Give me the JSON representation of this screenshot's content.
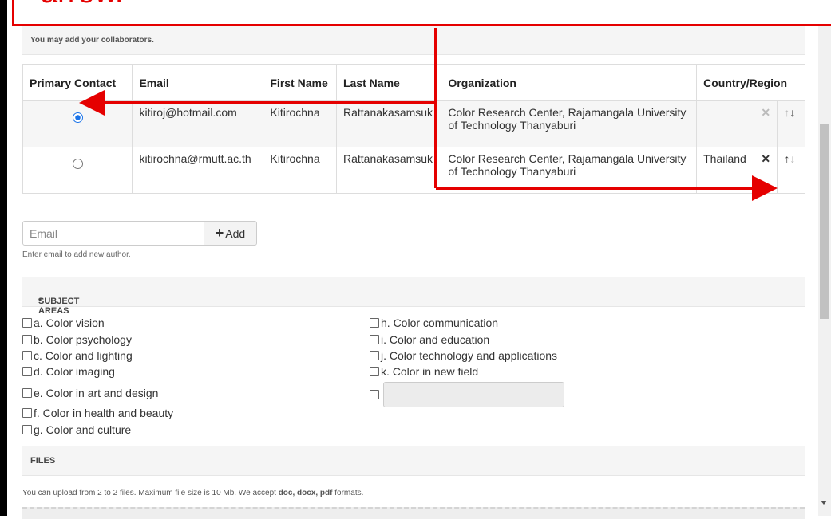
{
  "annotation": {
    "text": "arrow."
  },
  "collaborators_note": "You may add your collaborators.",
  "authors_table": {
    "headers": [
      "Primary Contact",
      "Email",
      "First Name",
      "Last Name",
      "Organization",
      "Country/Region"
    ],
    "rows": [
      {
        "primary": true,
        "email": "kitiroj@hotmail.com",
        "first": "Kitirochna",
        "last": "Rattanakasamsuk",
        "org": "Color Research Center, Rajamangala University of Technology Thanyaburi",
        "country": "",
        "remove": "✕",
        "up": "↑",
        "down": "↓"
      },
      {
        "primary": false,
        "email": "kitirochna@rmutt.ac.th",
        "first": "Kitirochna",
        "last": "Rattanakasamsuk",
        "org": "Color Research Center, Rajamangala University of Technology Thanyaburi",
        "country": "Thailand",
        "remove": "✕",
        "up": "↑",
        "down": "↓"
      }
    ]
  },
  "add_author": {
    "placeholder": "Email",
    "button": "Add",
    "hint": "Enter email to add new author."
  },
  "subject_areas": {
    "title": "SUBJECT AREAS",
    "required": "*",
    "left": [
      "a. Color vision",
      "b. Color psychology",
      "c. Color and lighting",
      "d. Color imaging",
      "e. Color in art and design",
      "f. Color in health and beauty",
      "g. Color and culture"
    ],
    "right": [
      "h. Color communication",
      "i. Color and education",
      "j. Color technology and applications",
      "k. Color in new field"
    ]
  },
  "files": {
    "title": "FILES",
    "note_prefix": "You can upload from 2 to 2 files. Maximum file size is 10 Mb. We accept ",
    "formats": "doc, docx, pdf",
    "note_suffix": " formats."
  },
  "colors": {
    "annotation": "#e50000",
    "radio_selected": "#1a73e8"
  }
}
